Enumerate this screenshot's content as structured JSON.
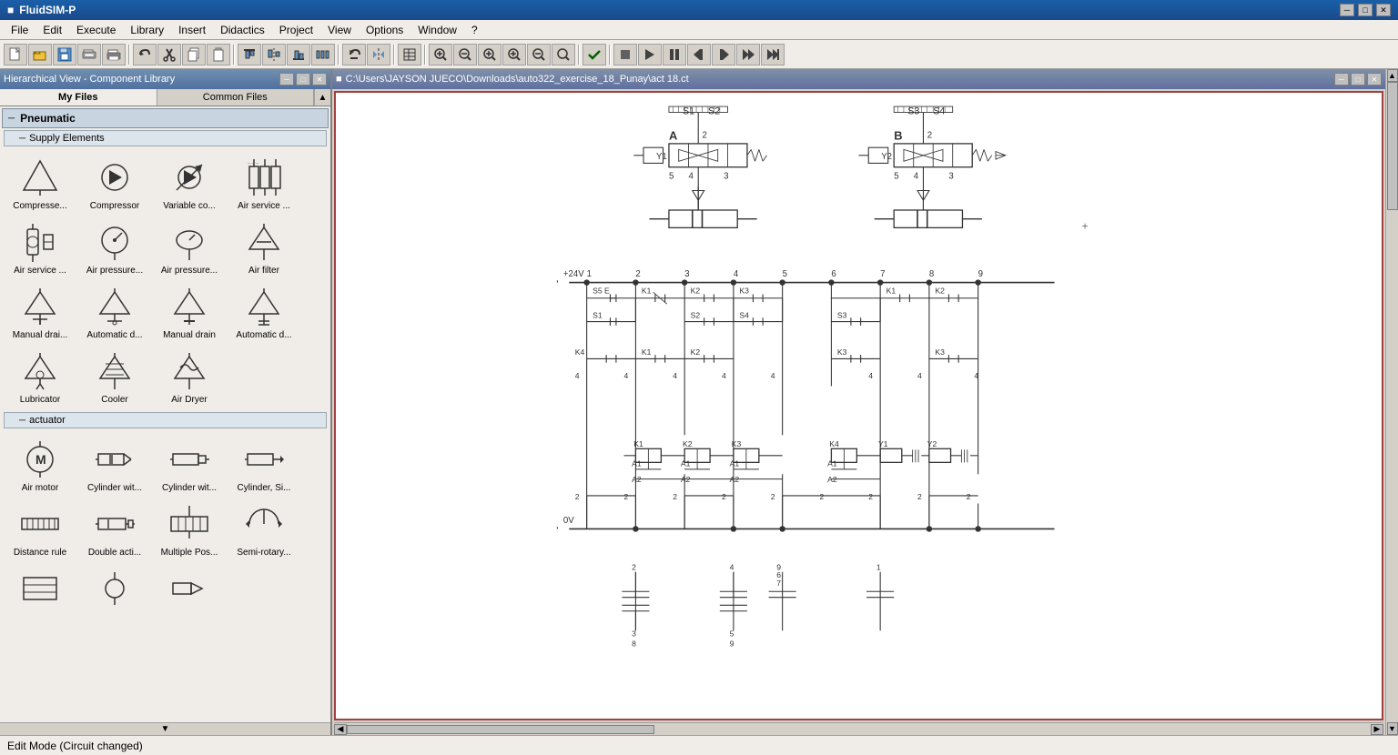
{
  "app": {
    "title": "FluidSIM-P",
    "logo": "F"
  },
  "title_bar": {
    "title": "FluidSIM-P",
    "min_label": "─",
    "max_label": "□",
    "close_label": "✕"
  },
  "menu_bar": {
    "items": [
      "File",
      "Edit",
      "Execute",
      "Library",
      "Insert",
      "Didactics",
      "Project",
      "View",
      "Options",
      "Window",
      "?"
    ]
  },
  "toolbar": {
    "buttons": [
      {
        "name": "new",
        "icon": "📄"
      },
      {
        "name": "open",
        "icon": "📂"
      },
      {
        "name": "save",
        "icon": "💾"
      },
      {
        "name": "print-preview",
        "icon": "🖨"
      },
      {
        "name": "print",
        "icon": "🖨"
      },
      {
        "name": "undo",
        "icon": "↩"
      },
      {
        "name": "cut",
        "icon": "✂"
      },
      {
        "name": "copy",
        "icon": "📋"
      },
      {
        "name": "paste",
        "icon": "📌"
      },
      {
        "name": "sep1",
        "icon": ""
      },
      {
        "name": "align-left",
        "icon": "⬅"
      },
      {
        "name": "align-center",
        "icon": "⬛"
      },
      {
        "name": "align-right",
        "icon": "➡"
      },
      {
        "name": "distribute",
        "icon": "⬛"
      },
      {
        "name": "sep2",
        "icon": ""
      },
      {
        "name": "rotate",
        "icon": "↺"
      },
      {
        "name": "mirror",
        "icon": "↔"
      },
      {
        "name": "sep3",
        "icon": ""
      },
      {
        "name": "table",
        "icon": "⊞"
      },
      {
        "name": "zoom-fit",
        "icon": "🔍"
      },
      {
        "name": "zoom-out2",
        "icon": "🔍"
      },
      {
        "name": "zoom-in2",
        "icon": "🔍"
      },
      {
        "name": "zoom-in",
        "icon": "🔍"
      },
      {
        "name": "zoom-out",
        "icon": "🔍"
      },
      {
        "name": "zoom-reset",
        "icon": "🔍"
      },
      {
        "name": "sep4",
        "icon": ""
      },
      {
        "name": "check",
        "icon": "✓"
      },
      {
        "name": "sep5",
        "icon": ""
      },
      {
        "name": "stop",
        "icon": "⏹"
      },
      {
        "name": "play",
        "icon": "▶"
      },
      {
        "name": "pause",
        "icon": "⏸"
      },
      {
        "name": "step-back",
        "icon": "⏮"
      },
      {
        "name": "step-fwd",
        "icon": "⏭"
      },
      {
        "name": "fast-fwd",
        "icon": "⏩"
      },
      {
        "name": "fast-fwd2",
        "icon": "⏭"
      }
    ]
  },
  "library_panel": {
    "title": "Hierarchical View - Component Library",
    "min_label": "─",
    "max_label": "□",
    "close_label": "✕",
    "tabs": [
      "My Files",
      "Common Files"
    ],
    "active_tab": "My Files",
    "categories": [
      {
        "name": "Pneumatic",
        "collapsed": false,
        "sub_categories": [
          {
            "name": "Supply Elements",
            "collapsed": false,
            "components": [
              {
                "label": "Compresse...",
                "icon": "triangle"
              },
              {
                "label": "Compressor",
                "icon": "circle-triangle"
              },
              {
                "label": "Variable co...",
                "icon": "var-comp"
              },
              {
                "label": "Air service ...",
                "icon": "air-service"
              },
              {
                "label": "Air service ...",
                "icon": "air-service2"
              },
              {
                "label": "Air pressure...",
                "icon": "gauge"
              },
              {
                "label": "Air pressure...",
                "icon": "gauge2"
              },
              {
                "label": "Air filter",
                "icon": "diamond"
              },
              {
                "label": "Manual drai...",
                "icon": "diamond-arrow"
              },
              {
                "label": "Automatic d...",
                "icon": "diamond-arrow2"
              },
              {
                "label": "Manual drain",
                "icon": "diamond-arrow3"
              },
              {
                "label": "Automatic d...",
                "icon": "diamond-arrow4"
              },
              {
                "label": "Lubricator",
                "icon": "diamond-drop"
              },
              {
                "label": "Cooler",
                "icon": "cooler"
              },
              {
                "label": "Air Dryer",
                "icon": "air-dryer"
              }
            ]
          },
          {
            "name": "actuator",
            "collapsed": false,
            "components": [
              {
                "label": "Air motor",
                "icon": "circle-m"
              },
              {
                "label": "Cylinder wit...",
                "icon": "cylinder1"
              },
              {
                "label": "Cylinder wit...",
                "icon": "cylinder2"
              },
              {
                "label": "Cylinder, Si...",
                "icon": "cylinder3"
              },
              {
                "label": "Distance rule",
                "icon": "distance"
              },
              {
                "label": "Double acti...",
                "icon": "double-act"
              },
              {
                "label": "Multiple Pos...",
                "icon": "multi-pos"
              },
              {
                "label": "Semi-rotary...",
                "icon": "semi-rot"
              },
              {
                "label": "...",
                "icon": "misc1"
              },
              {
                "label": "...",
                "icon": "misc2"
              },
              {
                "label": "...",
                "icon": "misc3"
              }
            ]
          }
        ]
      }
    ]
  },
  "canvas": {
    "title": "C:\\Users\\JAYSON JUECO\\Downloads\\auto322_exercise_18_Punay\\act 18.ct",
    "min_label": "─",
    "max_label": "□",
    "close_label": "✕"
  },
  "status_bar": {
    "message": "Edit Mode (Circuit changed)"
  }
}
